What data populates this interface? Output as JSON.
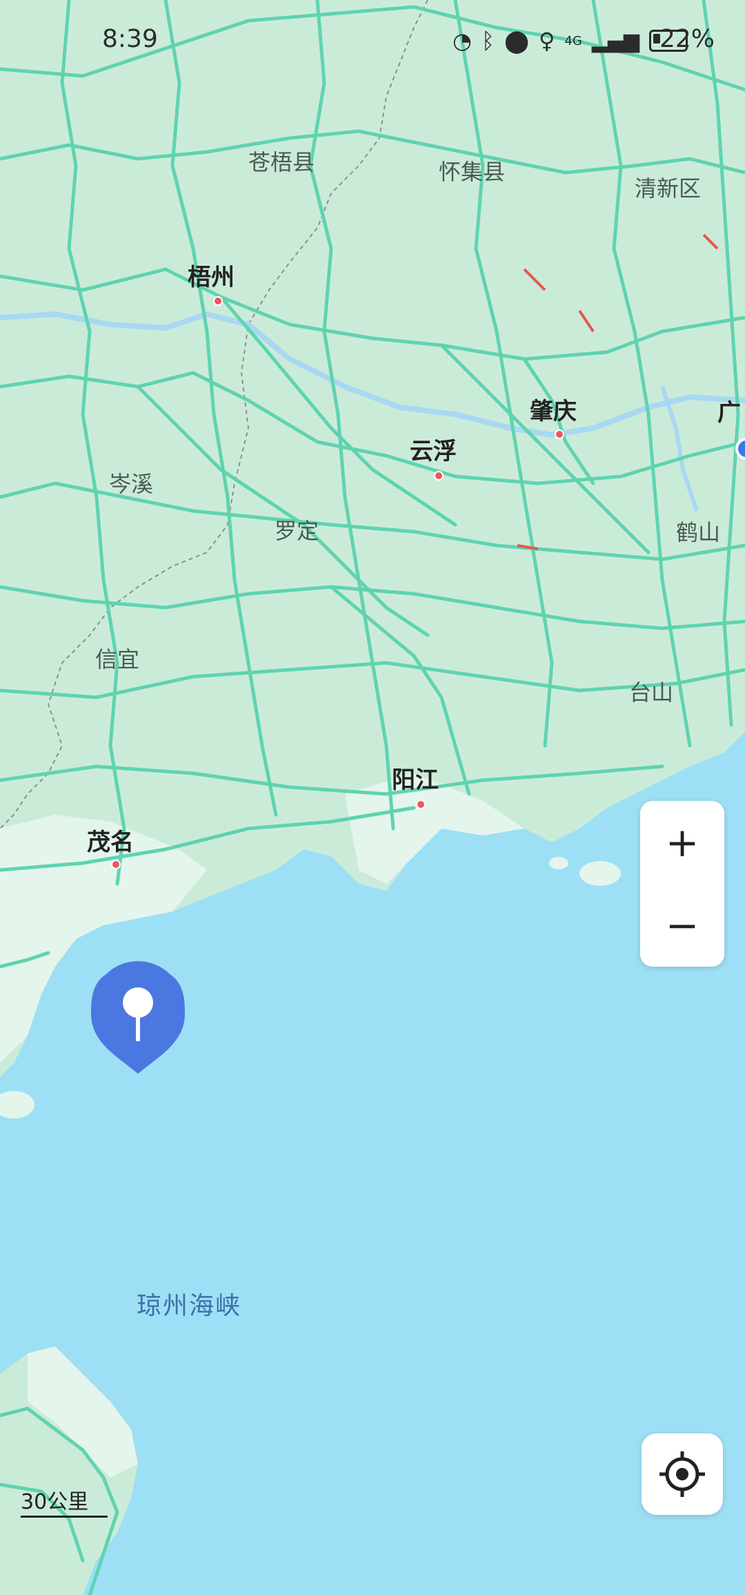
{
  "status_bar": {
    "time": "8:39",
    "battery": "22%",
    "network": "4G",
    "icons": [
      "speed-icon",
      "bluetooth-icon",
      "location-icon",
      "microphone-icon",
      "signal-icon",
      "battery-icon"
    ]
  },
  "map": {
    "cities": [
      {
        "key": "wuzhou",
        "label": "梧州"
      },
      {
        "key": "zhaoqing",
        "label": "肇庆"
      },
      {
        "key": "yunfu",
        "label": "云浮"
      },
      {
        "key": "yangjiang",
        "label": "阳江"
      },
      {
        "key": "maoming",
        "label": "茂名"
      },
      {
        "key": "guangzhou_partial",
        "label": "广"
      }
    ],
    "towns": [
      {
        "key": "cangwu",
        "label": "苍梧县"
      },
      {
        "key": "huaiji",
        "label": "怀集县"
      },
      {
        "key": "qingxin",
        "label": "清新区"
      },
      {
        "key": "cenxi",
        "label": "岑溪"
      },
      {
        "key": "luoding",
        "label": "罗定"
      },
      {
        "key": "heshan",
        "label": "鹤山"
      },
      {
        "key": "xinyi",
        "label": "信宜"
      },
      {
        "key": "taishan",
        "label": "台山"
      }
    ],
    "water": "琼州海峡",
    "colors": {
      "land": "#c9ead8",
      "sea": "#9ddff5",
      "road": "#5fd3b0",
      "pin": "#4a78e0",
      "city_dot": "#f0575a"
    }
  },
  "controls": {
    "zoom_in": "+",
    "zoom_out": "−",
    "locate_icon": "locate-crosshair-icon",
    "pin_icon": "map-pin-icon"
  },
  "scale": {
    "label": "30公里"
  }
}
